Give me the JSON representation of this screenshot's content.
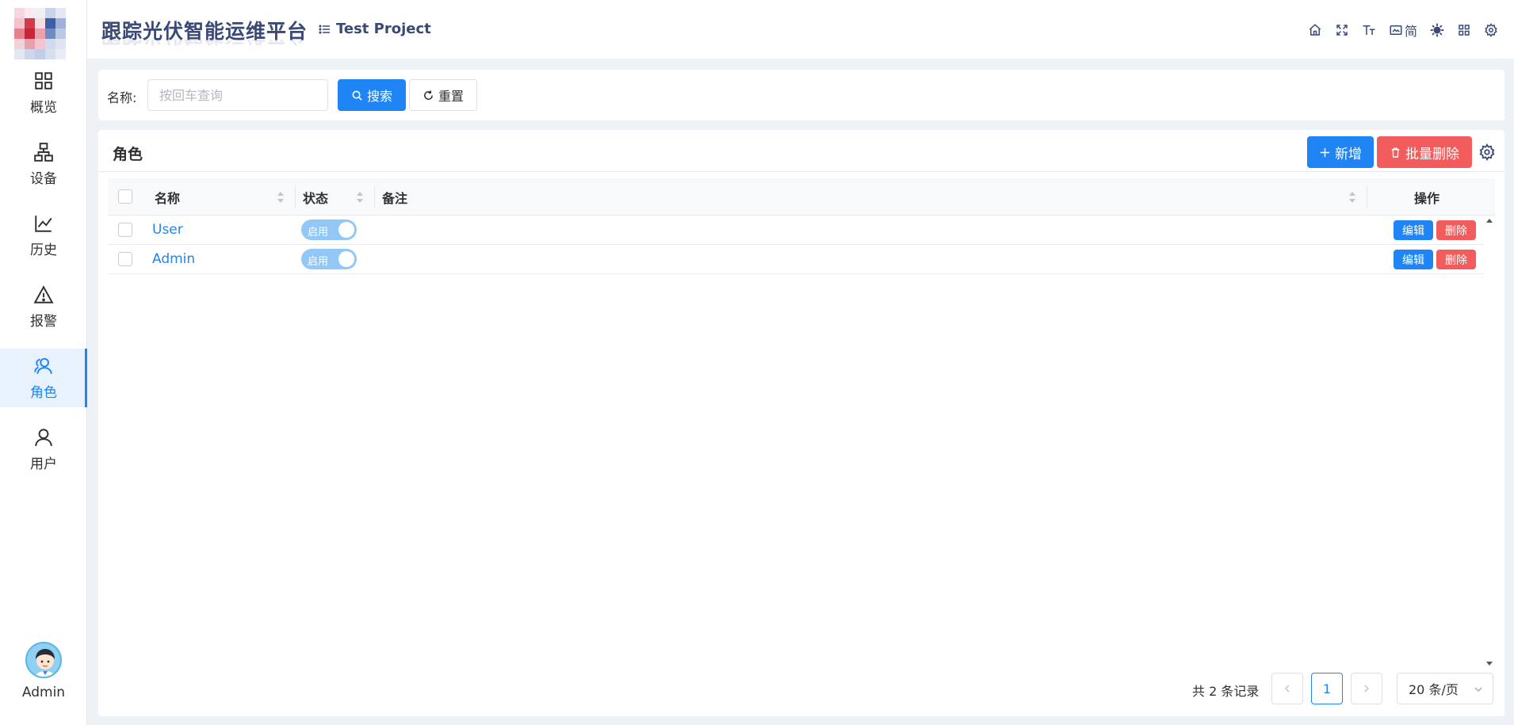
{
  "app": {
    "title": "跟踪光伏智能运维平台",
    "project": "Test Project"
  },
  "header_tools": [
    {
      "icon": "home-icon",
      "label": ""
    },
    {
      "icon": "fullscreen-icon",
      "label": ""
    },
    {
      "icon": "font-size-icon",
      "label": ""
    },
    {
      "icon": "language-icon",
      "label": "简"
    },
    {
      "icon": "theme-icon",
      "label": ""
    },
    {
      "icon": "layout-icon",
      "label": ""
    },
    {
      "icon": "settings-icon",
      "label": ""
    }
  ],
  "sidebar": {
    "items": [
      {
        "label": "概览",
        "icon": "dashboard-grid-icon",
        "active": false
      },
      {
        "label": "设备",
        "icon": "device-tree-icon",
        "active": false
      },
      {
        "label": "历史",
        "icon": "line-chart-icon",
        "active": false
      },
      {
        "label": "报警",
        "icon": "alert-triangle-icon",
        "active": false
      },
      {
        "label": "角色",
        "icon": "roles-icon",
        "active": true
      },
      {
        "label": "用户",
        "icon": "user-icon",
        "active": false
      }
    ],
    "user": {
      "name": "Admin"
    }
  },
  "search": {
    "label": "名称:",
    "placeholder": "按回车查询",
    "value": "",
    "search_button": "搜索",
    "reset_button": "重置"
  },
  "table": {
    "title": "角色",
    "add_button": "新增",
    "batch_delete_button": "批量删除",
    "columns": {
      "name": "名称",
      "status": "状态",
      "remark": "备注",
      "actions": "操作"
    },
    "rows": [
      {
        "name": "User",
        "status": "启用",
        "remark": "",
        "edit": "编辑",
        "delete": "删除"
      },
      {
        "name": "Admin",
        "status": "启用",
        "remark": "",
        "edit": "编辑",
        "delete": "删除"
      }
    ]
  },
  "pagination": {
    "total_text": "共 2 条记录",
    "current_page": "1",
    "page_size": "20 条/页"
  },
  "colors": {
    "primary": "#1f85f5",
    "danger": "#f25c5c",
    "title": "#3a4a78"
  }
}
